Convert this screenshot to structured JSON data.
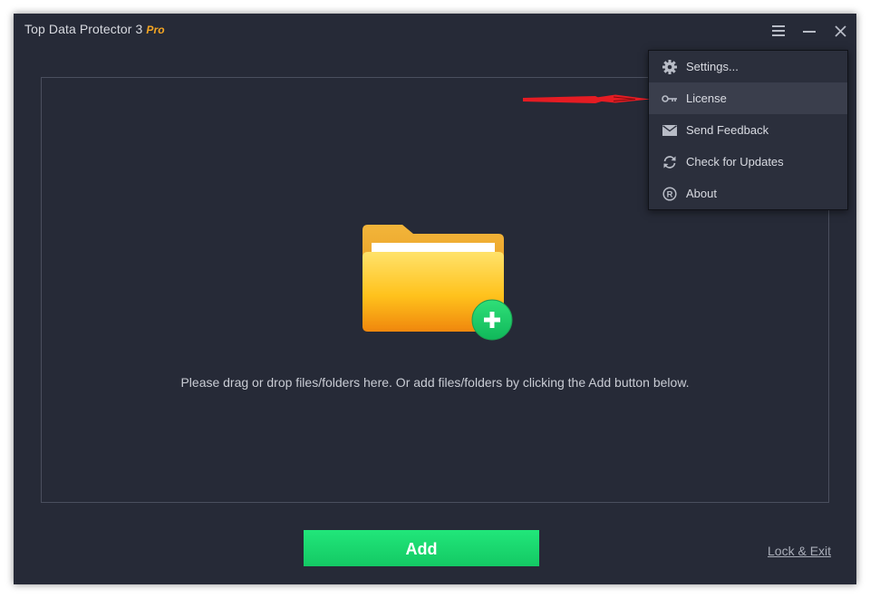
{
  "window": {
    "title": "Top Data Protector 3",
    "edition": "Pro"
  },
  "title_controls": [
    "menu-icon",
    "minimize-icon",
    "close-icon"
  ],
  "drop_zone": {
    "hint": "Please drag or drop files/folders here. Or add files/folders by clicking the Add button below.",
    "icon": "folder-add-icon"
  },
  "footer": {
    "add_label": "Add",
    "lock_exit_label": "Lock & Exit"
  },
  "menu": {
    "items": [
      {
        "label": "Settings...",
        "icon": "gear-icon"
      },
      {
        "label": "License",
        "icon": "key-icon"
      },
      {
        "label": "Send Feedback",
        "icon": "envelope-icon"
      },
      {
        "label": "Check for Updates",
        "icon": "refresh-icon"
      },
      {
        "label": "About",
        "icon": "registered-icon"
      }
    ],
    "highlighted_index": 1
  },
  "colors": {
    "background": "#262a37",
    "accent_green": "#1ad66c",
    "pro_orange": "#f5a623",
    "annotation_arrow": "#e51c23"
  }
}
